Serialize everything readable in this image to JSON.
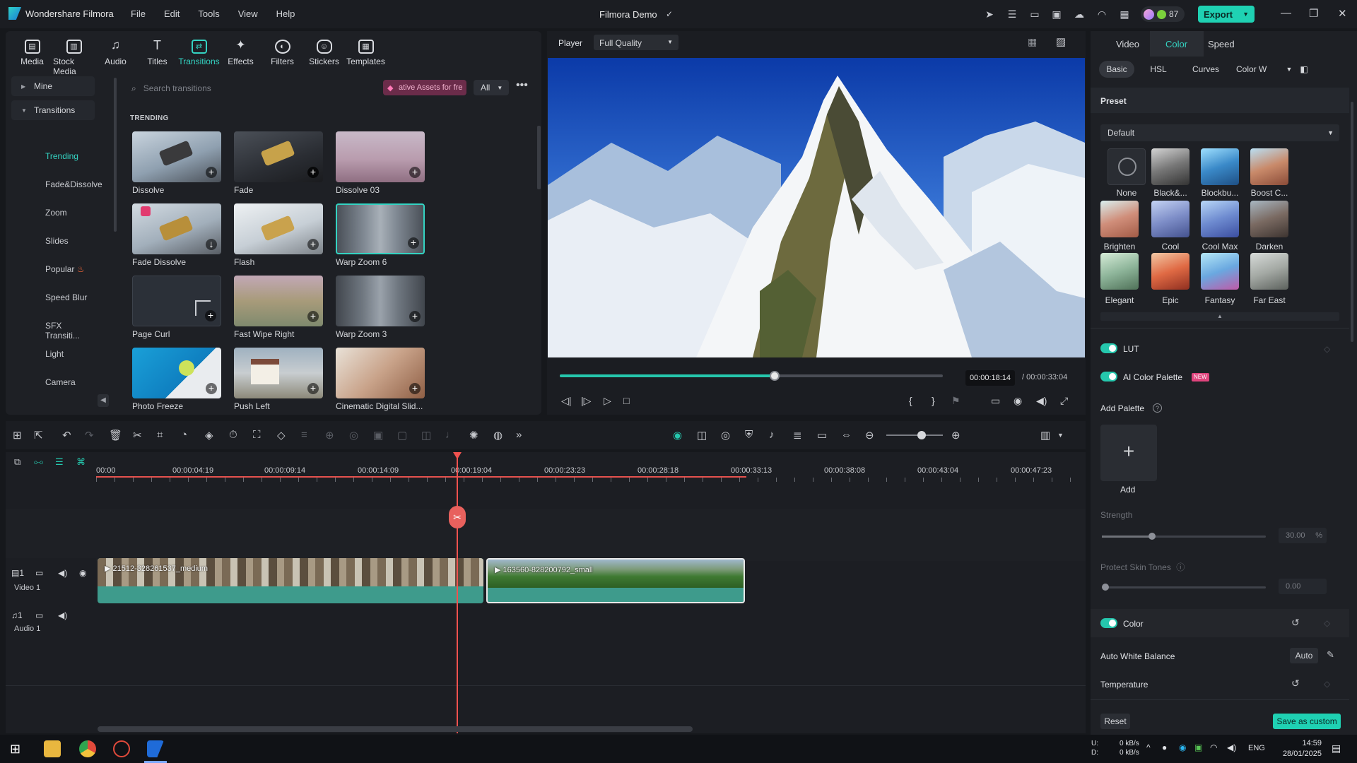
{
  "titlebar": {
    "app_name": "Wondershare Filmora",
    "menu": [
      "File",
      "Edit",
      "Tools",
      "View",
      "Help"
    ],
    "project_title": "Filmora Demo",
    "credits": "87",
    "export_label": "Export"
  },
  "library": {
    "tabs": [
      "Media",
      "Stock Media",
      "Audio",
      "Titles",
      "Transitions",
      "Effects",
      "Filters",
      "Stickers",
      "Templates"
    ],
    "active_tab": "Transitions",
    "nav": {
      "mine": "Mine",
      "transitions": "Transitions",
      "subitems": [
        "Trending",
        "Fade&Dissolve",
        "Zoom",
        "Slides",
        "Popular",
        "Speed Blur",
        "SFX Transiti...",
        "Light",
        "Camera"
      ]
    },
    "search_placeholder": "Search transitions",
    "promo": "ative Assets for fre",
    "filter": "All",
    "section": "TRENDING",
    "items": [
      {
        "label": "Dissolve"
      },
      {
        "label": "Fade"
      },
      {
        "label": "Dissolve 03"
      },
      {
        "label": "Fade Dissolve"
      },
      {
        "label": "Flash"
      },
      {
        "label": "Warp Zoom 6"
      },
      {
        "label": "Page Curl"
      },
      {
        "label": "Fast Wipe Right"
      },
      {
        "label": "Warp Zoom 3"
      },
      {
        "label": "Photo Freeze"
      },
      {
        "label": "Push Left"
      },
      {
        "label": "Cinematic Digital Slid..."
      }
    ]
  },
  "player": {
    "label": "Player",
    "quality": "Full Quality",
    "current_time": "00:00:18:14",
    "total_time": "/ 00:00:33:04",
    "progress": 0.56
  },
  "right_panel": {
    "tabs": [
      "Video",
      "Color",
      "Speed"
    ],
    "active_tab": "Color",
    "subtabs": [
      "Basic",
      "HSL",
      "Curves",
      "Color W"
    ],
    "preset_title": "Preset",
    "preset_value": "Default",
    "presets": [
      "None",
      "Black&...",
      "Blockbu...",
      "Boost C...",
      "Brighten",
      "Cool",
      "Cool Max",
      "Darken",
      "Elegant",
      "Epic",
      "Fantasy",
      "Far East"
    ],
    "lut": "LUT",
    "ai_palette": "AI Color Palette",
    "new_badge": "NEW",
    "add_palette": "Add Palette",
    "add": "Add",
    "strength": "Strength",
    "strength_value": "30.00",
    "strength_unit": "%",
    "protect_skin": "Protect Skin Tones",
    "protect_value": "0.00",
    "color": "Color",
    "auto_wb": "Auto White Balance",
    "auto": "Auto",
    "temperature": "Temperature",
    "reset": "Reset",
    "save_custom": "Save as custom"
  },
  "timeline": {
    "ruler": [
      "00:00",
      "00:00:04:19",
      "00:00:09:14",
      "00:00:14:09",
      "00:00:19:04",
      "00:00:23:23",
      "00:00:28:18",
      "00:00:33:13",
      "00:00:38:08",
      "00:00:43:04",
      "00:00:47:23"
    ],
    "video_track": "Video 1",
    "audio_track": "Audio 1",
    "clip1": "21512-328261537_medium",
    "clip2": "163560-828200792_small"
  },
  "taskbar": {
    "net_up": "0 kB/s",
    "net_down": "0 kB/s",
    "net_u": "U:",
    "net_d": "D:",
    "lang": "ENG",
    "time": "14:59",
    "date": "28/01/2025"
  }
}
